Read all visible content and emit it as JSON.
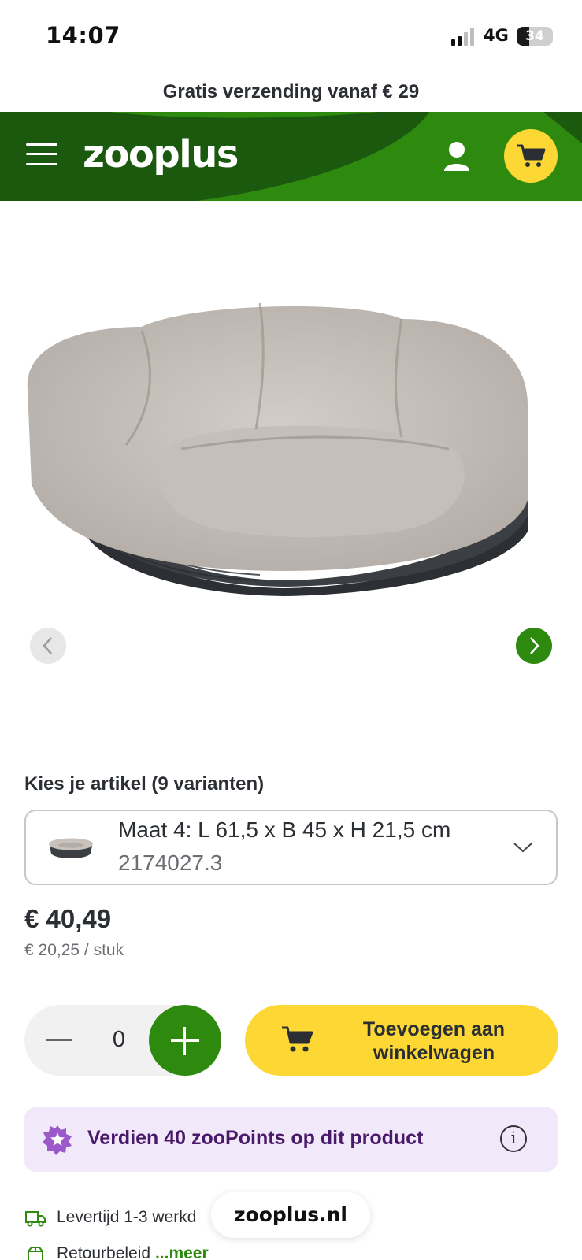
{
  "status_bar": {
    "time": "14:07",
    "network": "4G",
    "battery": "34",
    "battery_level": 0.34
  },
  "promo": {
    "text": "Gratis verzending vanaf € 29"
  },
  "header": {
    "logo": "zooplus",
    "menu_icon": "hamburger-icon",
    "user_icon": "user-icon",
    "cart_icon": "cart-icon",
    "colors": {
      "dark_green": "#1b5a0e",
      "bright_green": "#2e8a0e",
      "yellow": "#fdd835"
    }
  },
  "gallery": {
    "image_alt": "dog-bed-image",
    "prev_icon": "chevron-left-icon",
    "next_icon": "chevron-right-icon"
  },
  "variants": {
    "title": "Kies je artikel (9 varianten)",
    "selected_name": "Maat 4: L 61,5 x B 45 x H 21,5 cm",
    "selected_sku": "2174027.3",
    "chevron_icon": "chevron-down-icon"
  },
  "pricing": {
    "price": "€ 40,49",
    "unit_price": "€ 20,25 / stuk"
  },
  "purchase": {
    "quantity": "0",
    "minus_icon": "minus-icon",
    "plus_icon": "plus-icon",
    "add_to_cart": "Toevoegen aan winkelwagen"
  },
  "zoopoints": {
    "text": "Verdien 40 zooPoints op dit product",
    "info_icon": "i"
  },
  "info_rows": {
    "delivery": "Levertijd 1-3 werkd",
    "returns_label": "Retourbeleid",
    "returns_link": "...meer"
  },
  "browser": {
    "url": "zooplus.nl"
  }
}
